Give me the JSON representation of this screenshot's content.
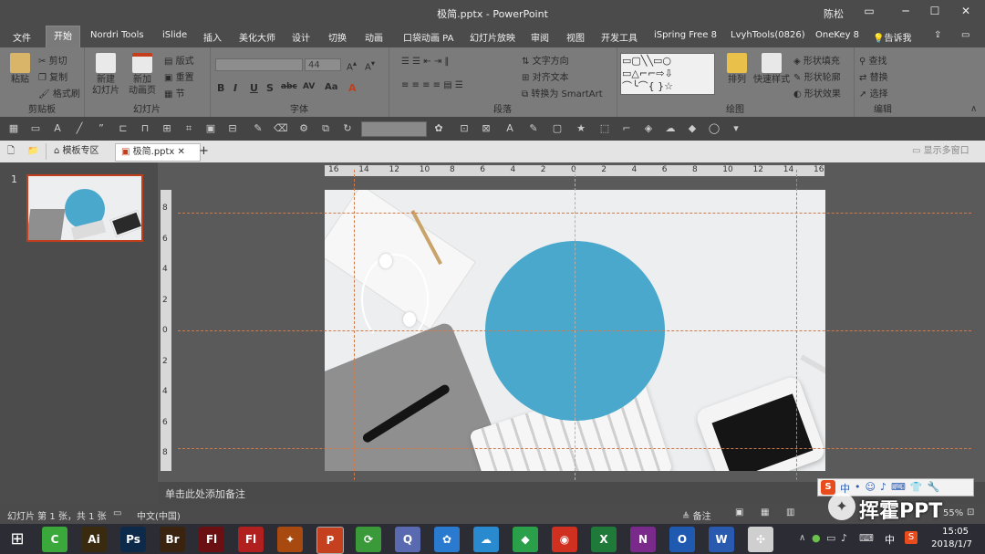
{
  "window": {
    "title": "极简.pptx  -  PowerPoint",
    "user": "陈松"
  },
  "menu": [
    "文件",
    "开始",
    "Nordri Tools",
    "iSlide",
    "插入",
    "美化大师",
    "设计",
    "切换",
    "动画",
    "口袋动画 PA",
    "幻灯片放映",
    "审阅",
    "视图",
    "开发工具",
    "iSpring Free 8",
    "LvyhTools(0826)",
    "OneKey 8",
    "告诉我"
  ],
  "ribbon": {
    "clipboard": {
      "paste": "粘贴",
      "cut": "剪切",
      "copy": "复制",
      "format_painter": "格式刷",
      "label": "剪贴板"
    },
    "slides": {
      "new_slide": "新建\n幻灯片",
      "new_anim": "新加\n动画页",
      "layout": "版式",
      "reset": "重置",
      "section": "节",
      "label": "幻灯片"
    },
    "font": {
      "name": "",
      "size": "44",
      "label": "字体"
    },
    "paragraph": {
      "text_dir": "文字方向",
      "align_text": "对齐文本",
      "smartart": "转换为 SmartArt",
      "label": "段落"
    },
    "drawing": {
      "arrange": "排列",
      "quick_styles": "快速样式",
      "shape_fill": "形状填充",
      "shape_outline": "形状轮廓",
      "shape_effects": "形状效果",
      "label": "绘图"
    },
    "editing": {
      "find": "查找",
      "replace": "替换",
      "select": "选择",
      "label": "编辑"
    }
  },
  "doctabs": {
    "template": "模板专区",
    "file": "极简.pptx",
    "show_multi": "显示多窗口"
  },
  "thumbnails": {
    "slide_number": "1"
  },
  "ruler": {
    "h_ticks": [
      "16",
      "14",
      "12",
      "10",
      "8",
      "6",
      "4",
      "2",
      "0",
      "2",
      "4",
      "6",
      "8",
      "10",
      "12",
      "14",
      "16"
    ],
    "v_ticks": [
      "8",
      "6",
      "4",
      "2",
      "0",
      "2",
      "4",
      "6",
      "8"
    ]
  },
  "notes": {
    "placeholder": "单击此处添加备注"
  },
  "status": {
    "slide_info": "幻灯片 第 1 张，共 1 张",
    "language": "中文(中国)",
    "notes_btn": "备注",
    "zoom": "55%"
  },
  "watermark": {
    "text": "挥霍PPT"
  },
  "taskbar": {
    "time": "15:05",
    "date": "2018/1/7",
    "ime": "中",
    "apps": [
      {
        "label": "C",
        "color": "#3aa83a"
      },
      {
        "label": "Ai",
        "color": "#3a2a10"
      },
      {
        "label": "Ps",
        "color": "#0d2a4a"
      },
      {
        "label": "Br",
        "color": "#3a2410"
      },
      {
        "label": "Fl",
        "color": "#6a0f12"
      },
      {
        "label": "Fl",
        "color": "#b21f1f"
      },
      {
        "label": "✦",
        "color": "#a84a10"
      },
      {
        "label": "P",
        "color": "#c4401f"
      },
      {
        "label": "⟳",
        "color": "#3a9a3a"
      },
      {
        "label": "Q",
        "color": "#5a6ab0"
      },
      {
        "label": "✿",
        "color": "#2a7ad0"
      },
      {
        "label": "☁",
        "color": "#2a8ad0"
      },
      {
        "label": "◆",
        "color": "#2aa04a"
      },
      {
        "label": "◉",
        "color": "#d03020"
      },
      {
        "label": "X",
        "color": "#1f7a3a"
      },
      {
        "label": "N",
        "color": "#7a2a8a"
      },
      {
        "label": "O",
        "color": "#1f5ab0"
      },
      {
        "label": "W",
        "color": "#2a5ab0"
      },
      {
        "label": "✣",
        "color": "#cfcfcf"
      }
    ]
  },
  "colors": {
    "circle": "#4aa8cc",
    "accent": "#c43e1c"
  }
}
